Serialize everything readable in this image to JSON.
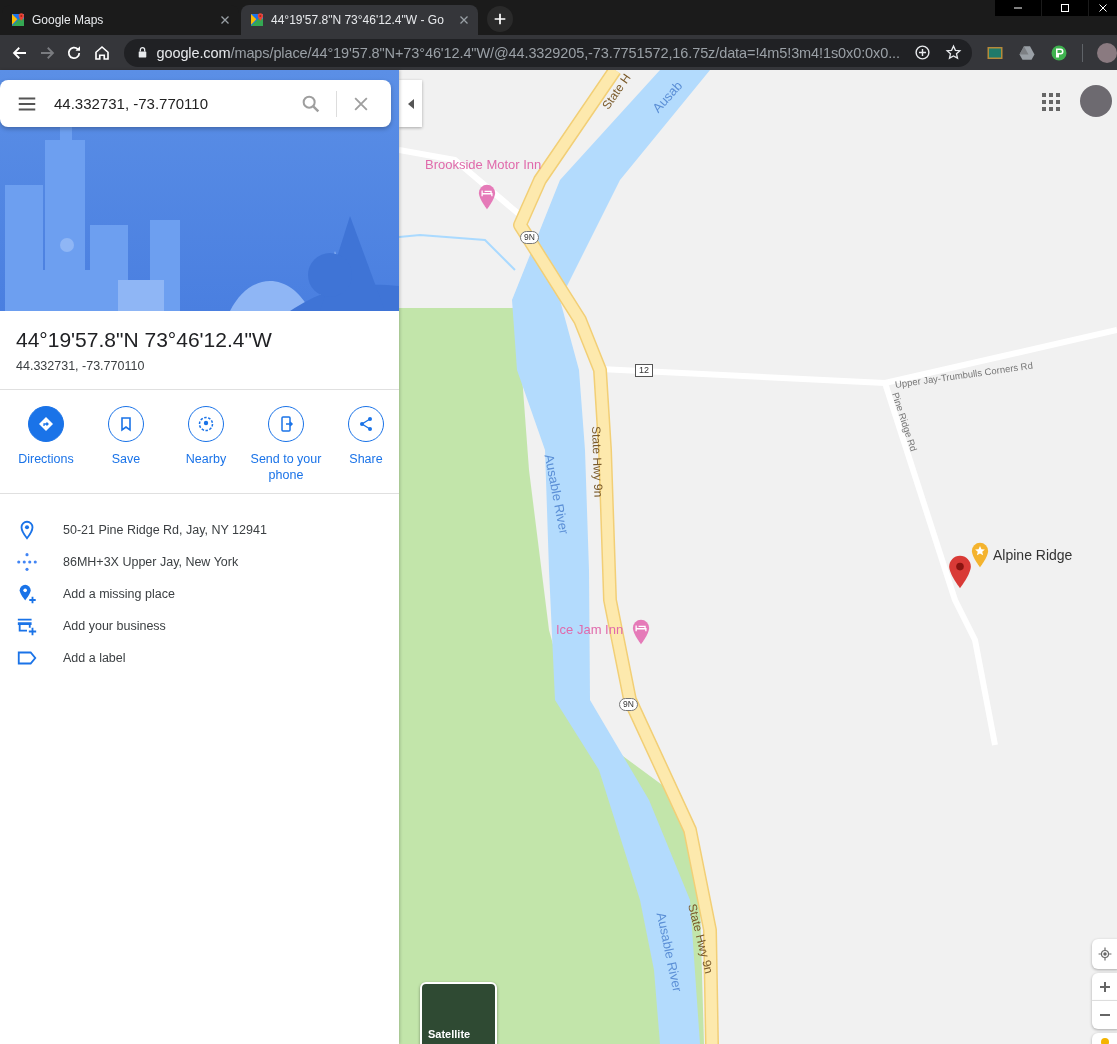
{
  "browser": {
    "tabs": [
      {
        "title": "Google Maps",
        "selected": false
      },
      {
        "title": "44°19'57.8\"N 73°46'12.4\"W - Go",
        "selected": true
      }
    ],
    "nav": [
      {
        "kind": "back",
        "disabled": false
      },
      {
        "kind": "forward",
        "disabled": true
      },
      {
        "kind": "reload",
        "disabled": false
      },
      {
        "kind": "home",
        "disabled": false
      }
    ],
    "address": {
      "host": "google.com",
      "path": "/maps/place/44°19'57.8\"N+73°46'12.4\"W/@44.3329205,-73.7751572,16.75z/data=!4m5!3m4!1s0x0:0x0..."
    }
  },
  "search": {
    "value": "44.332731, -73.770110"
  },
  "place": {
    "title": "44°19'57.8\"N 73°46'12.4\"W",
    "subtitle": "44.332731, -73.770110"
  },
  "actions": [
    {
      "kind": "directions",
      "label": "Directions",
      "primary": true
    },
    {
      "kind": "save",
      "label": "Save",
      "primary": false
    },
    {
      "kind": "nearby",
      "label": "Nearby",
      "primary": false
    },
    {
      "kind": "send",
      "label": "Send to your phone",
      "primary": false
    },
    {
      "kind": "share",
      "label": "Share",
      "primary": false
    }
  ],
  "details": [
    {
      "kind": "address",
      "text": "50-21 Pine Ridge Rd, Jay, NY 12941"
    },
    {
      "kind": "plus_code",
      "text": "86MH+3X Upper Jay, New York"
    },
    {
      "kind": "add_place",
      "text": "Add a missing place"
    },
    {
      "kind": "add_business",
      "text": "Add your business"
    },
    {
      "kind": "add_label",
      "text": "Add a label"
    }
  ],
  "map": {
    "labels": [
      {
        "kind": "hotel",
        "text": "Brookside Motor Inn"
      },
      {
        "kind": "road",
        "text": "State H"
      },
      {
        "kind": "river",
        "text": "Ausab"
      },
      {
        "kind": "shield",
        "text": "9N"
      },
      {
        "kind": "route",
        "text": "12"
      },
      {
        "kind": "street",
        "text": "Upper Jay-Trumbulls Corners Rd"
      },
      {
        "kind": "street",
        "text": "Pine Ridge Rd"
      },
      {
        "kind": "road",
        "text": "State Hwy 9n"
      },
      {
        "kind": "river",
        "text": "Ausable River"
      },
      {
        "kind": "hotel",
        "text": "Ice Jam Inn"
      },
      {
        "kind": "shield",
        "text": "9N"
      },
      {
        "kind": "place",
        "text": "Alpine Ridge"
      },
      {
        "kind": "road",
        "text": "State Hwy 9n"
      },
      {
        "kind": "river",
        "text": "Ausable River"
      }
    ],
    "layer": {
      "label": "Satellite"
    }
  }
}
